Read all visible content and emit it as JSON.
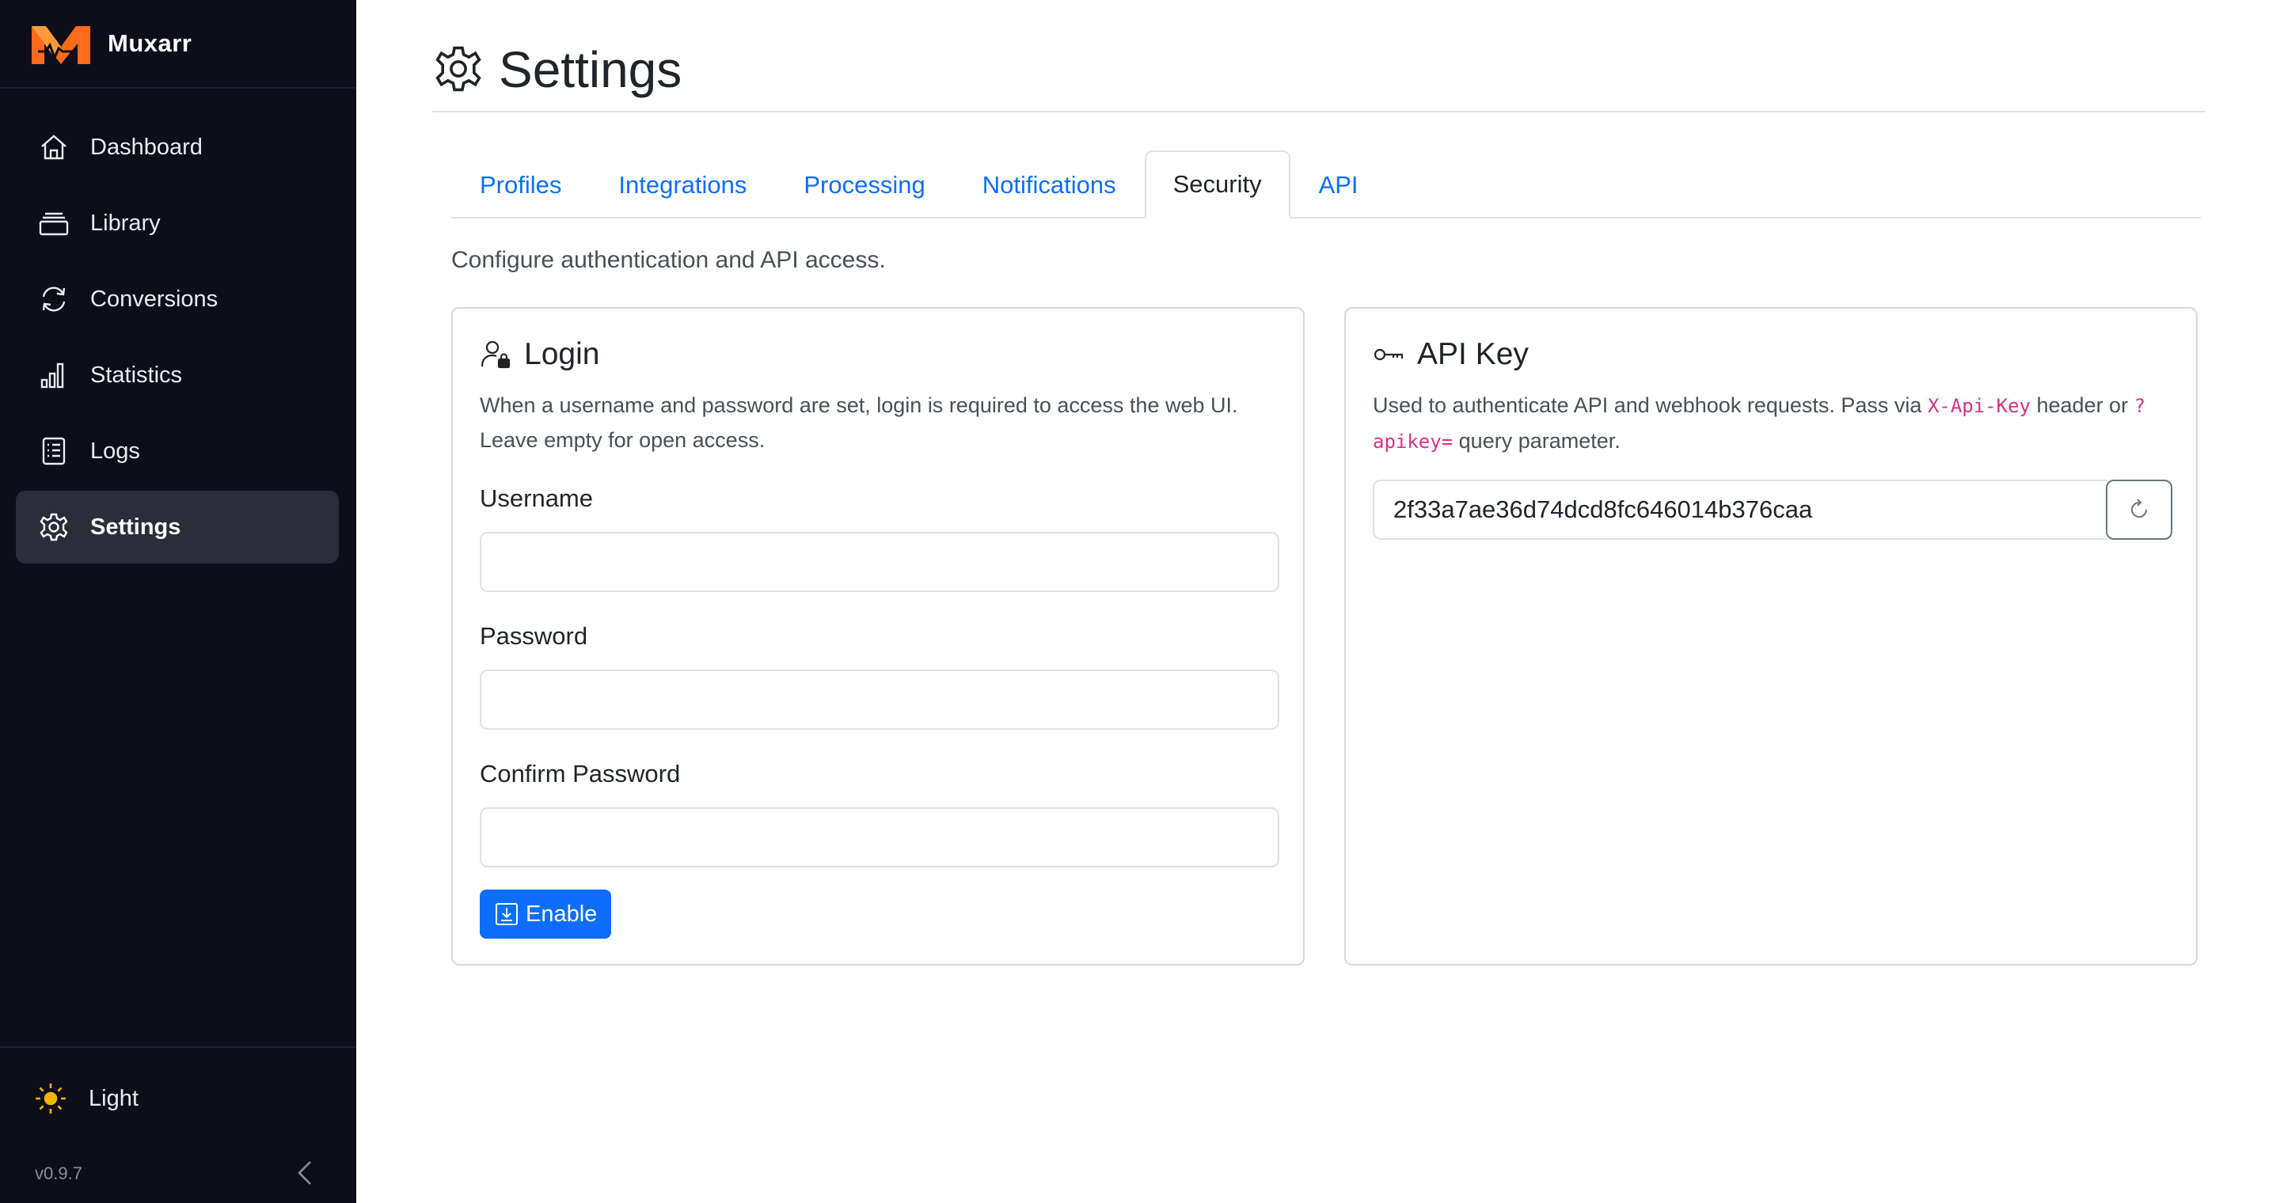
{
  "app": {
    "name": "Muxarr",
    "version": "v0.9.7"
  },
  "colors": {
    "sidebar_bg": "#0d0e1a",
    "accent": "#0d6efd",
    "code": "#d63384",
    "logo_orange": "#ff6b1a"
  },
  "sidebar": {
    "items": [
      {
        "label": "Dashboard",
        "icon": "house-icon"
      },
      {
        "label": "Library",
        "icon": "collection-icon"
      },
      {
        "label": "Conversions",
        "icon": "refresh-icon"
      },
      {
        "label": "Statistics",
        "icon": "bar-chart-icon"
      },
      {
        "label": "Logs",
        "icon": "log-file-icon"
      },
      {
        "label": "Settings",
        "icon": "gear-icon",
        "active": true
      }
    ],
    "theme_label": "Light"
  },
  "page": {
    "title": "Settings",
    "tabs": [
      {
        "label": "Profiles"
      },
      {
        "label": "Integrations"
      },
      {
        "label": "Processing"
      },
      {
        "label": "Notifications"
      },
      {
        "label": "Security",
        "active": true
      },
      {
        "label": "API"
      }
    ],
    "intro": "Configure authentication and API access."
  },
  "login": {
    "title": "Login",
    "description": "When a username and password are set, login is required to access the web UI. Leave empty for open access.",
    "username_label": "Username",
    "username_value": "",
    "password_label": "Password",
    "password_value": "",
    "confirm_label": "Confirm Password",
    "confirm_value": "",
    "enable_label": "Enable"
  },
  "apikey": {
    "title": "API Key",
    "desc_prefix": "Used to authenticate API and webhook requests. Pass via ",
    "header_code": "X-Api-Key",
    "desc_middle": " header or ",
    "query_code": "?apikey=",
    "desc_suffix": " query parameter.",
    "value": "2f33a7ae36d74dcd8fc646014b376caa"
  }
}
